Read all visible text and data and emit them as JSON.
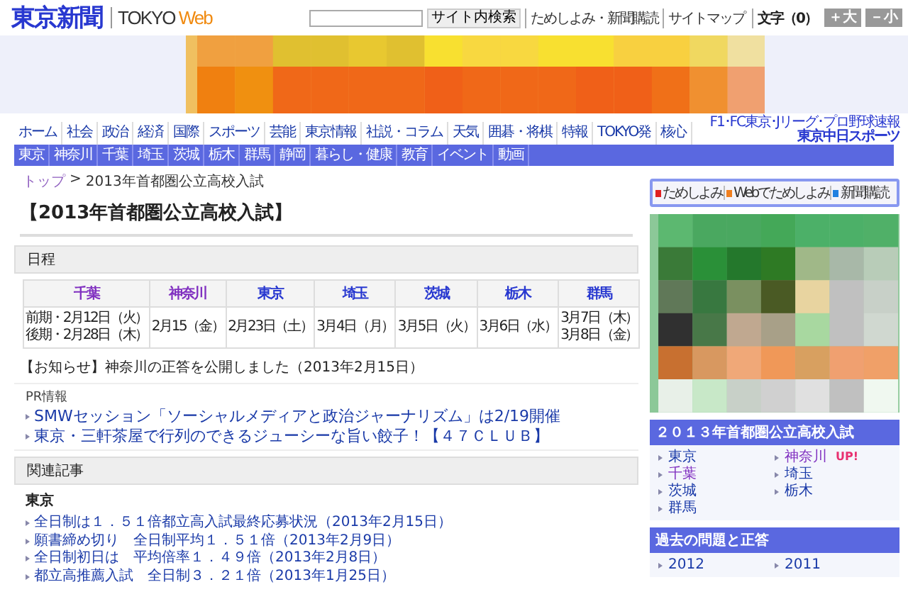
{
  "header": {
    "logo": "東京新聞",
    "brand": "TOKYO",
    "brand_accent": "Web",
    "search_button": "サイト内検索",
    "links": [
      "ためしよみ・新聞購読",
      "サイトマップ"
    ],
    "font_label": "文字（0）",
    "font_buttons": [
      "＋大",
      "－小"
    ]
  },
  "nav_main": [
    "ホーム",
    "社会",
    "政治",
    "経済",
    "国際",
    "スポーツ",
    "芸能",
    "東京情報",
    "社説・コラム",
    "天気",
    "囲碁・将棋",
    "特報",
    "TOKYO発",
    "核心"
  ],
  "sports": {
    "caption": "F1･FC東京･Jリーグ･プロ野球速報",
    "logo": "東京中日スポーツ"
  },
  "nav_sub": [
    "東京",
    "神奈川",
    "千葉",
    "埼玉",
    "茨城",
    "栃木",
    "群馬",
    "静岡",
    "暮らし・健康",
    "教育",
    "イベント",
    "動画"
  ],
  "breadcrumb": {
    "top": "トップ",
    "separator": ">",
    "current": "2013年首都圏公立高校入試"
  },
  "page_title": "【2013年首都圏公立高校入試】",
  "schedule": {
    "heading": "日程",
    "columns": [
      {
        "label": "千葉",
        "visited": true
      },
      {
        "label": "神奈川",
        "visited": true
      },
      {
        "label": "東京",
        "visited": false
      },
      {
        "label": "埼玉",
        "visited": false
      },
      {
        "label": "茨城",
        "visited": false
      },
      {
        "label": "栃木",
        "visited": false
      },
      {
        "label": "群馬",
        "visited": false
      }
    ],
    "cells": [
      [
        "前期・2月12日（火）",
        "後期・2月28日（木）"
      ],
      [
        "2月15（金）"
      ],
      [
        "2月23日（土）"
      ],
      [
        "3月4日（月）"
      ],
      [
        "3月5日（火）"
      ],
      [
        "3月6日（水）"
      ],
      [
        "3月7日（木）",
        "3月8日（金）"
      ]
    ]
  },
  "notice": "【お知らせ】神奈川の正答を公開しました（2013年2月15日）",
  "pr": {
    "heading": "PR情報",
    "links": [
      "SMWセッション「ソーシャルメディアと政治ジャーナリズム」は2/19開催",
      "東京・三軒茶屋で行列のできるジューシーな旨い餃子！【４７ＣＬＵＢ】"
    ]
  },
  "related": {
    "heading": "関連記事",
    "group": "東京",
    "links": [
      "全日制は１．５１倍都立高入試最終応募状況（2013年2月15日）",
      "願書締め切り　全日制平均１．５１倍（2013年2月9日）",
      "全日制初日は　平均倍率１．４９倍（2013年2月8日）",
      "都立高推薦入試　全日制３．２１倍（2013年1月25日）"
    ]
  },
  "sidebar": {
    "buttons": [
      {
        "label": "ためしよみ",
        "color": "#e02020"
      },
      {
        "label": "Webでためしよみ",
        "color": "#f08020"
      },
      {
        "label": "新聞購読",
        "color": "#2080e0"
      }
    ],
    "sections": [
      {
        "title": "２０１３年首都圏公立高校入試",
        "items": [
          {
            "label": "東京",
            "visited": false
          },
          {
            "label": "神奈川",
            "visited": true,
            "badge": "UP!"
          },
          {
            "label": "千葉",
            "visited": true
          },
          {
            "label": "埼玉",
            "visited": false
          },
          {
            "label": "茨城",
            "visited": false
          },
          {
            "label": "栃木",
            "visited": false
          },
          {
            "label": "群馬",
            "visited": false
          }
        ]
      },
      {
        "title": "過去の問題と正答",
        "items": [
          {
            "label": "2012",
            "visited": false
          },
          {
            "label": "2011",
            "visited": false
          }
        ]
      }
    ]
  }
}
